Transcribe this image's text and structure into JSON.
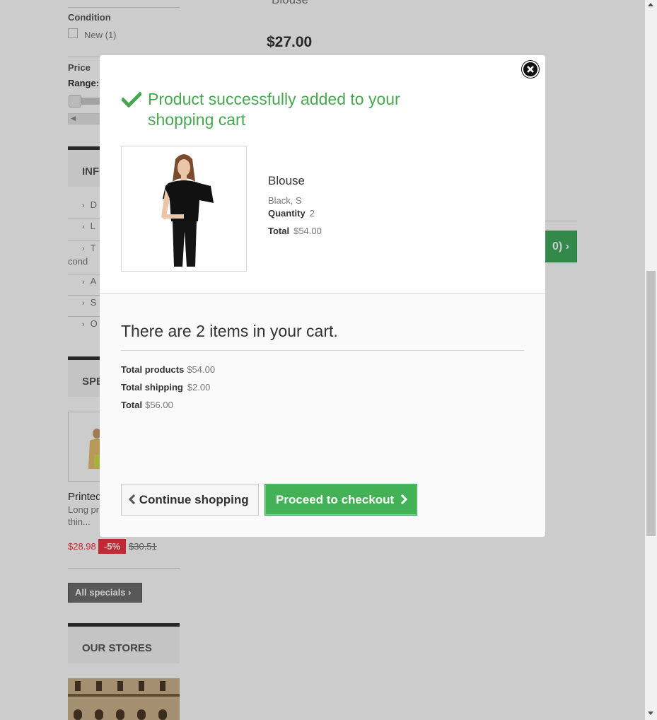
{
  "background": {
    "filters": {
      "condition_title": "Condition",
      "condition_option": "New (1)",
      "price_title": "Price",
      "range_label": "Range:"
    },
    "information": {
      "title": "INFO",
      "items": [
        "D",
        "L",
        "T",
        "cond",
        "A",
        "S",
        "O"
      ]
    },
    "specials": {
      "title": "SPE",
      "product_name": "Printed",
      "description_1": "Long pr",
      "description_2": "thin...",
      "price": "$28.98",
      "discount": "-5%",
      "old_price": "$30.51",
      "all_specials_label": "All specials"
    },
    "stores": {
      "title": "OUR STORES"
    },
    "product_listing": {
      "name": "Blouse",
      "price": "$27.00",
      "right_button_label": "0)"
    }
  },
  "modal": {
    "success_message": "Product successfully added to your shopping cart",
    "product": {
      "name": "Blouse",
      "attributes": "Black, S",
      "quantity_label": "Quantity",
      "quantity_value": "2",
      "total_label": "Total",
      "total_value": "$54.00"
    },
    "cart": {
      "count_text": "There are 2 items in your cart.",
      "total_products_label": "Total products",
      "total_products_value": "$54.00",
      "total_shipping_label": "Total shipping",
      "total_shipping_value": "$2.00",
      "total_label": "Total",
      "total_value": "$56.00"
    },
    "buttons": {
      "continue_label": "Continue shopping",
      "checkout_label": "Proceed to checkout"
    }
  },
  "colors": {
    "success_green": "#46a74e",
    "checkout_green": "#43b155",
    "price_red": "#f13340"
  }
}
